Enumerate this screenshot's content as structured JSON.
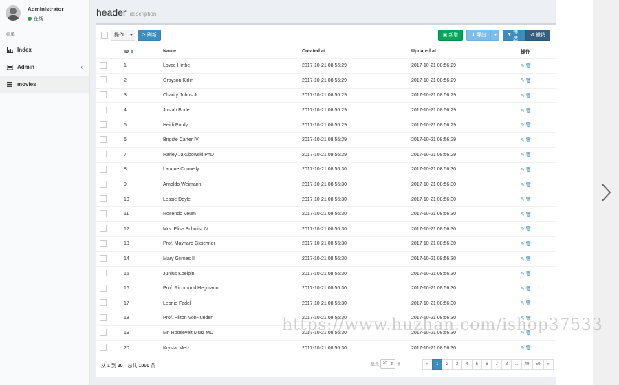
{
  "user": {
    "name": "Administrator",
    "status": "在线"
  },
  "sidebar": {
    "header": "菜单",
    "items": [
      {
        "label": "Index",
        "icon": "bar-chart-icon"
      },
      {
        "label": "Admin",
        "icon": "tasks-icon",
        "expand": "‹"
      },
      {
        "label": "movies",
        "icon": "bars-icon"
      }
    ]
  },
  "header": {
    "title": "header",
    "description": "description"
  },
  "toolbar": {
    "actions_label": "操作",
    "refresh_label": "刷新",
    "new_label": "新增",
    "export_label": "导出",
    "filter_label": "筛选",
    "reset_label": "撤销"
  },
  "table": {
    "columns": {
      "id": "ID",
      "name": "Name",
      "created_at": "Created at",
      "updated_at": "Updated at",
      "actions": "操作"
    },
    "rows": [
      {
        "id": "1",
        "name": "Loyce Hirthe",
        "created_at": "2017-10-21 08:56:29",
        "updated_at": "2017-10-21 08:56:29"
      },
      {
        "id": "2",
        "name": "Grayson Kirlin",
        "created_at": "2017-10-21 08:56:29",
        "updated_at": "2017-10-21 08:56:29"
      },
      {
        "id": "3",
        "name": "Charity Johns Jr.",
        "created_at": "2017-10-21 08:56:29",
        "updated_at": "2017-10-21 08:56:29"
      },
      {
        "id": "4",
        "name": "Josiah Bode",
        "created_at": "2017-10-21 08:56:29",
        "updated_at": "2017-10-21 08:56:29"
      },
      {
        "id": "5",
        "name": "Heidi Purdy",
        "created_at": "2017-10-21 08:56:29",
        "updated_at": "2017-10-21 08:56:29"
      },
      {
        "id": "6",
        "name": "Brigitte Carter IV",
        "created_at": "2017-10-21 08:56:29",
        "updated_at": "2017-10-21 08:56:29"
      },
      {
        "id": "7",
        "name": "Harley Jakubowski PhD",
        "created_at": "2017-10-21 08:56:29",
        "updated_at": "2017-10-21 08:56:29"
      },
      {
        "id": "8",
        "name": "Laurine Connelly",
        "created_at": "2017-10-21 08:56:30",
        "updated_at": "2017-10-21 08:56:30"
      },
      {
        "id": "9",
        "name": "Arnoldo Weimann",
        "created_at": "2017-10-21 08:56:30",
        "updated_at": "2017-10-21 08:56:30"
      },
      {
        "id": "10",
        "name": "Lessie Doyle",
        "created_at": "2017-10-21 08:56:30",
        "updated_at": "2017-10-21 08:56:30"
      },
      {
        "id": "11",
        "name": "Rosendo Veum",
        "created_at": "2017-10-21 08:56:30",
        "updated_at": "2017-10-21 08:56:30"
      },
      {
        "id": "12",
        "name": "Mrs. Elise Schulist IV",
        "created_at": "2017-10-21 08:56:30",
        "updated_at": "2017-10-21 08:56:30"
      },
      {
        "id": "13",
        "name": "Prof. Maynard Gleichner",
        "created_at": "2017-10-21 08:56:30",
        "updated_at": "2017-10-21 08:56:30"
      },
      {
        "id": "14",
        "name": "Mary Grimes II",
        "created_at": "2017-10-21 08:56:30",
        "updated_at": "2017-10-21 08:56:30"
      },
      {
        "id": "15",
        "name": "Junius Koelpin",
        "created_at": "2017-10-21 08:56:30",
        "updated_at": "2017-10-21 08:56:30"
      },
      {
        "id": "16",
        "name": "Prof. Richmond Hegmann",
        "created_at": "2017-10-21 08:56:30",
        "updated_at": "2017-10-21 08:56:30"
      },
      {
        "id": "17",
        "name": "Leonie Fadel",
        "created_at": "2017-10-21 08:56:30",
        "updated_at": "2017-10-21 08:56:30"
      },
      {
        "id": "18",
        "name": "Prof. Hilton VonRueden",
        "created_at": "2017-10-21 08:56:30",
        "updated_at": "2017-10-21 08:56:30"
      },
      {
        "id": "19",
        "name": "Mr. Roosevelt Mraz MD",
        "created_at": "2017-10-21 08:56:30",
        "updated_at": "2017-10-21 08:56:30"
      },
      {
        "id": "20",
        "name": "Krystal Metz",
        "created_at": "2017-10-21 08:56:30",
        "updated_at": "2017-10-21 08:56:30"
      }
    ]
  },
  "footer": {
    "summary_prefix": "从",
    "from": "1",
    "to_word": "到",
    "to": "20",
    "total_word": "，总共",
    "total": "1000",
    "unit": "条",
    "per_page_label": "显示",
    "per_page_value": "20",
    "per_page_unit": "条",
    "pages": [
      "«",
      "1",
      "2",
      "3",
      "4",
      "5",
      "6",
      "7",
      "8",
      "...",
      "49",
      "50",
      "»"
    ],
    "active_page": "1"
  },
  "watermark": "https://www.huzhan.com/ishop37533",
  "colors": {
    "primary": "#3c8dbc",
    "success": "#00a65a",
    "info": "#7fbde9",
    "dark": "#34607e",
    "sidebar_bg": "#f9fafc",
    "content_bg": "#ecf0f5"
  }
}
